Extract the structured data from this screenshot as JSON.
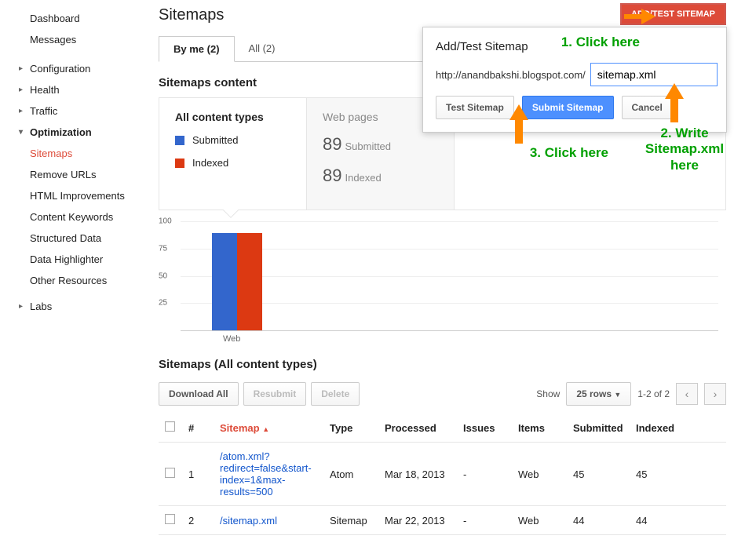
{
  "sidebar": {
    "dashboard": "Dashboard",
    "messages": "Messages",
    "configuration": "Configuration",
    "health": "Health",
    "traffic": "Traffic",
    "optimization": "Optimization",
    "sitemaps": "Sitemaps",
    "remove_urls": "Remove URLs",
    "html_improvements": "HTML Improvements",
    "content_keywords": "Content Keywords",
    "structured_data": "Structured Data",
    "data_highlighter": "Data Highlighter",
    "other_resources": "Other Resources",
    "labs": "Labs"
  },
  "page": {
    "title": "Sitemaps",
    "add_btn": "ADD/TEST SITEMAP",
    "tab_byme": "By me (2)",
    "tab_all": "All (2)",
    "section_content": "Sitemaps content",
    "section_all": "Sitemaps (All content types)"
  },
  "legend": {
    "all_types": "All content types",
    "submitted": "Submitted",
    "indexed": "Indexed",
    "webpages": "Web pages",
    "num_submitted": "89",
    "lbl_submitted": "Submitted",
    "num_indexed": "89",
    "lbl_indexed": "Indexed"
  },
  "colors": {
    "blue": "#3366cc",
    "red": "#dc3912"
  },
  "chart_data": {
    "type": "bar",
    "categories": [
      "Web"
    ],
    "series": [
      {
        "name": "Submitted",
        "values": [
          89
        ],
        "color": "#3366cc"
      },
      {
        "name": "Indexed",
        "values": [
          89
        ],
        "color": "#dc3912"
      }
    ],
    "ylim": [
      0,
      100
    ],
    "yticks": [
      25,
      50,
      75,
      100
    ],
    "xlabel": "",
    "ylabel": "",
    "title": ""
  },
  "chart": {
    "y100": "100",
    "y75": "75",
    "y50": "50",
    "y25": "25",
    "xcat": "Web"
  },
  "toolbar": {
    "download": "Download All",
    "resubmit": "Resubmit",
    "delete": "Delete",
    "show": "Show",
    "rows": "25 rows",
    "range": "1-2 of 2"
  },
  "table": {
    "headers": {
      "num": "#",
      "sitemap": "Sitemap",
      "sort": "▲",
      "type": "Type",
      "processed": "Processed",
      "issues": "Issues",
      "items": "Items",
      "submitted": "Submitted",
      "indexed": "Indexed"
    },
    "rows": [
      {
        "num": "1",
        "sitemap": "/atom.xml?redirect=false&start-index=1&max-results=500",
        "type": "Atom",
        "processed": "Mar 18, 2013",
        "issues": "-",
        "items": "Web",
        "submitted": "45",
        "indexed": "45"
      },
      {
        "num": "2",
        "sitemap": "/sitemap.xml",
        "type": "Sitemap",
        "processed": "Mar 22, 2013",
        "issues": "-",
        "items": "Web",
        "submitted": "44",
        "indexed": "44"
      }
    ]
  },
  "popup": {
    "title": "Add/Test Sitemap",
    "base_url": "http://anandbakshi.blogspot.com/",
    "input_value": "sitemap.xml",
    "test": "Test Sitemap",
    "submit": "Submit Sitemap",
    "cancel": "Cancel"
  },
  "anno": {
    "a1": "1. Click here",
    "a2": "2. Write Sitemap.xml here",
    "a3": "3. Click here"
  }
}
